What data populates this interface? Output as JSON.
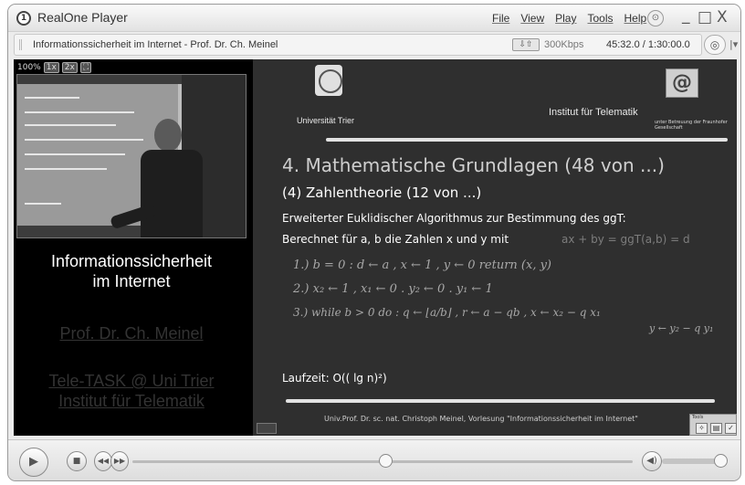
{
  "app": {
    "title": "RealOne Player",
    "logo_icon": "realone-logo-icon",
    "menu": [
      "File",
      "View",
      "Play",
      "Tools",
      "Help"
    ],
    "window_controls": {
      "minimize": "_",
      "restore": "□",
      "close": "X"
    }
  },
  "infobar": {
    "clip_title": "Informationssicherheit im Internet - Prof. Dr. Ch. Meinel",
    "bitrate": "300Kbps",
    "timecode": "45:32.0 / 1:30:00.0"
  },
  "video": {
    "zoom_label": "100%",
    "zoom_1x": "1x",
    "zoom_2x": "2x"
  },
  "left_panel": {
    "course_title": "Informationssicherheit\nim Internet",
    "professor": "Prof. Dr. Ch. Meinel",
    "institute": "Tele-TASK @ Uni Trier\nInstitut für Telematik"
  },
  "slide": {
    "university": "Universität Trier",
    "institute": "Institut für Telematik",
    "logo_caption": "unter Betreuung der Fraunhofer Gesellschaft",
    "heading": "4. Mathematische Grundlagen (48 von ...)",
    "subheading": "(4) Zahlentheorie (12 von ...)",
    "line1": "Erweiterter Euklidischer Algorithmus zur Bestimmung des  ggT:",
    "line2": "Berechnet für  a, b  die Zahlen  x  und  y  mit",
    "formula": "ax + by = ggT(a,b) = d",
    "handwriting": [
      "1.) b = 0 :   d ← a , x ← 1 , y ← 0   return (x, y)",
      "2.)  x₂ ← 1 , x₁ ← 0 . y₂ ← 0 . y₁ ← 1",
      "3.)  while  b > 0  do :   q ← ⌊a/b⌋ , r ← a − qb ,  x ← x₂ − q x₁",
      "y ← y₂ − q y₁"
    ],
    "laufzeit_label": "Laufzeit:",
    "laufzeit_value": "O(( lg n)²)",
    "footer": "Univ.Prof. Dr. sc. nat. Christoph Meinel, Vorlesung \"Informationssicherheit im Internet\"",
    "tools_label": "Tools"
  },
  "playback": {
    "position_fraction": 0.506,
    "volume_fraction": 1.0
  }
}
